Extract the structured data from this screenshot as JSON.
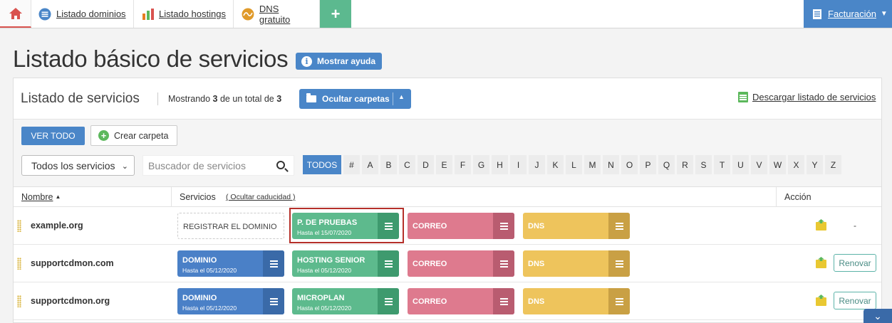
{
  "tabs": {
    "home_label": "",
    "dominios": "Listado dominios",
    "hostings": "Listado hostings",
    "dns": "DNS gratuito",
    "plus": "+",
    "facturacion": "Facturación"
  },
  "page": {
    "title": "Listado básico de servicios",
    "help_button": "Mostrar ayuda"
  },
  "panel": {
    "title": "Listado de servicios",
    "showing_prefix": "Mostrando",
    "showing_count": "3",
    "showing_middle": "de un total de",
    "showing_total": "3",
    "hide_folders": "Ocultar carpetas",
    "download": "Descargar listado de servicios"
  },
  "toolbar": {
    "view_all": "VER TODO",
    "create_folder": "Crear carpeta",
    "filter_value": "Todos los servicios",
    "search_placeholder": "Buscador de servicios",
    "letters": [
      "TODOS",
      "#",
      "A",
      "B",
      "C",
      "D",
      "E",
      "F",
      "G",
      "H",
      "I",
      "J",
      "K",
      "L",
      "M",
      "N",
      "O",
      "P",
      "Q",
      "R",
      "S",
      "T",
      "U",
      "V",
      "W",
      "X",
      "Y",
      "Z"
    ]
  },
  "table": {
    "col_name": "Nombre",
    "col_services": "Servicios",
    "col_hide_expiry": "( Ocultar caducidad )",
    "col_action": "Acción",
    "rows": [
      {
        "domain": "example.org",
        "cards": [
          {
            "title": "REGISTRAR EL DOMINIO",
            "sub": ""
          },
          {
            "title": "P. DE PRUEBAS",
            "sub": "Hasta el 15/07/2020"
          },
          {
            "title": "CORREO",
            "sub": ""
          },
          {
            "title": "DNS",
            "sub": ""
          }
        ],
        "action": "-"
      },
      {
        "domain": "supportcdmon.com",
        "cards": [
          {
            "title": "DOMINIO",
            "sub": "Hasta el 05/12/2020"
          },
          {
            "title": "HOSTING SENIOR",
            "sub": "Hasta el 05/12/2020"
          },
          {
            "title": "CORREO",
            "sub": ""
          },
          {
            "title": "DNS",
            "sub": ""
          }
        ],
        "action": "Renovar"
      },
      {
        "domain": "supportcdmon.org",
        "cards": [
          {
            "title": "DOMINIO",
            "sub": "Hasta el 05/12/2020"
          },
          {
            "title": "MICROPLAN",
            "sub": "Hasta el 05/12/2020"
          },
          {
            "title": "CORREO",
            "sub": ""
          },
          {
            "title": "DNS",
            "sub": ""
          }
        ],
        "action": "Renovar"
      }
    ]
  },
  "colors": {
    "accent_blue": "#4a86c8",
    "green": "#5dba8d",
    "pink": "#de7a8e",
    "yellow": "#eec45c",
    "highlight_red": "#b5302a"
  }
}
